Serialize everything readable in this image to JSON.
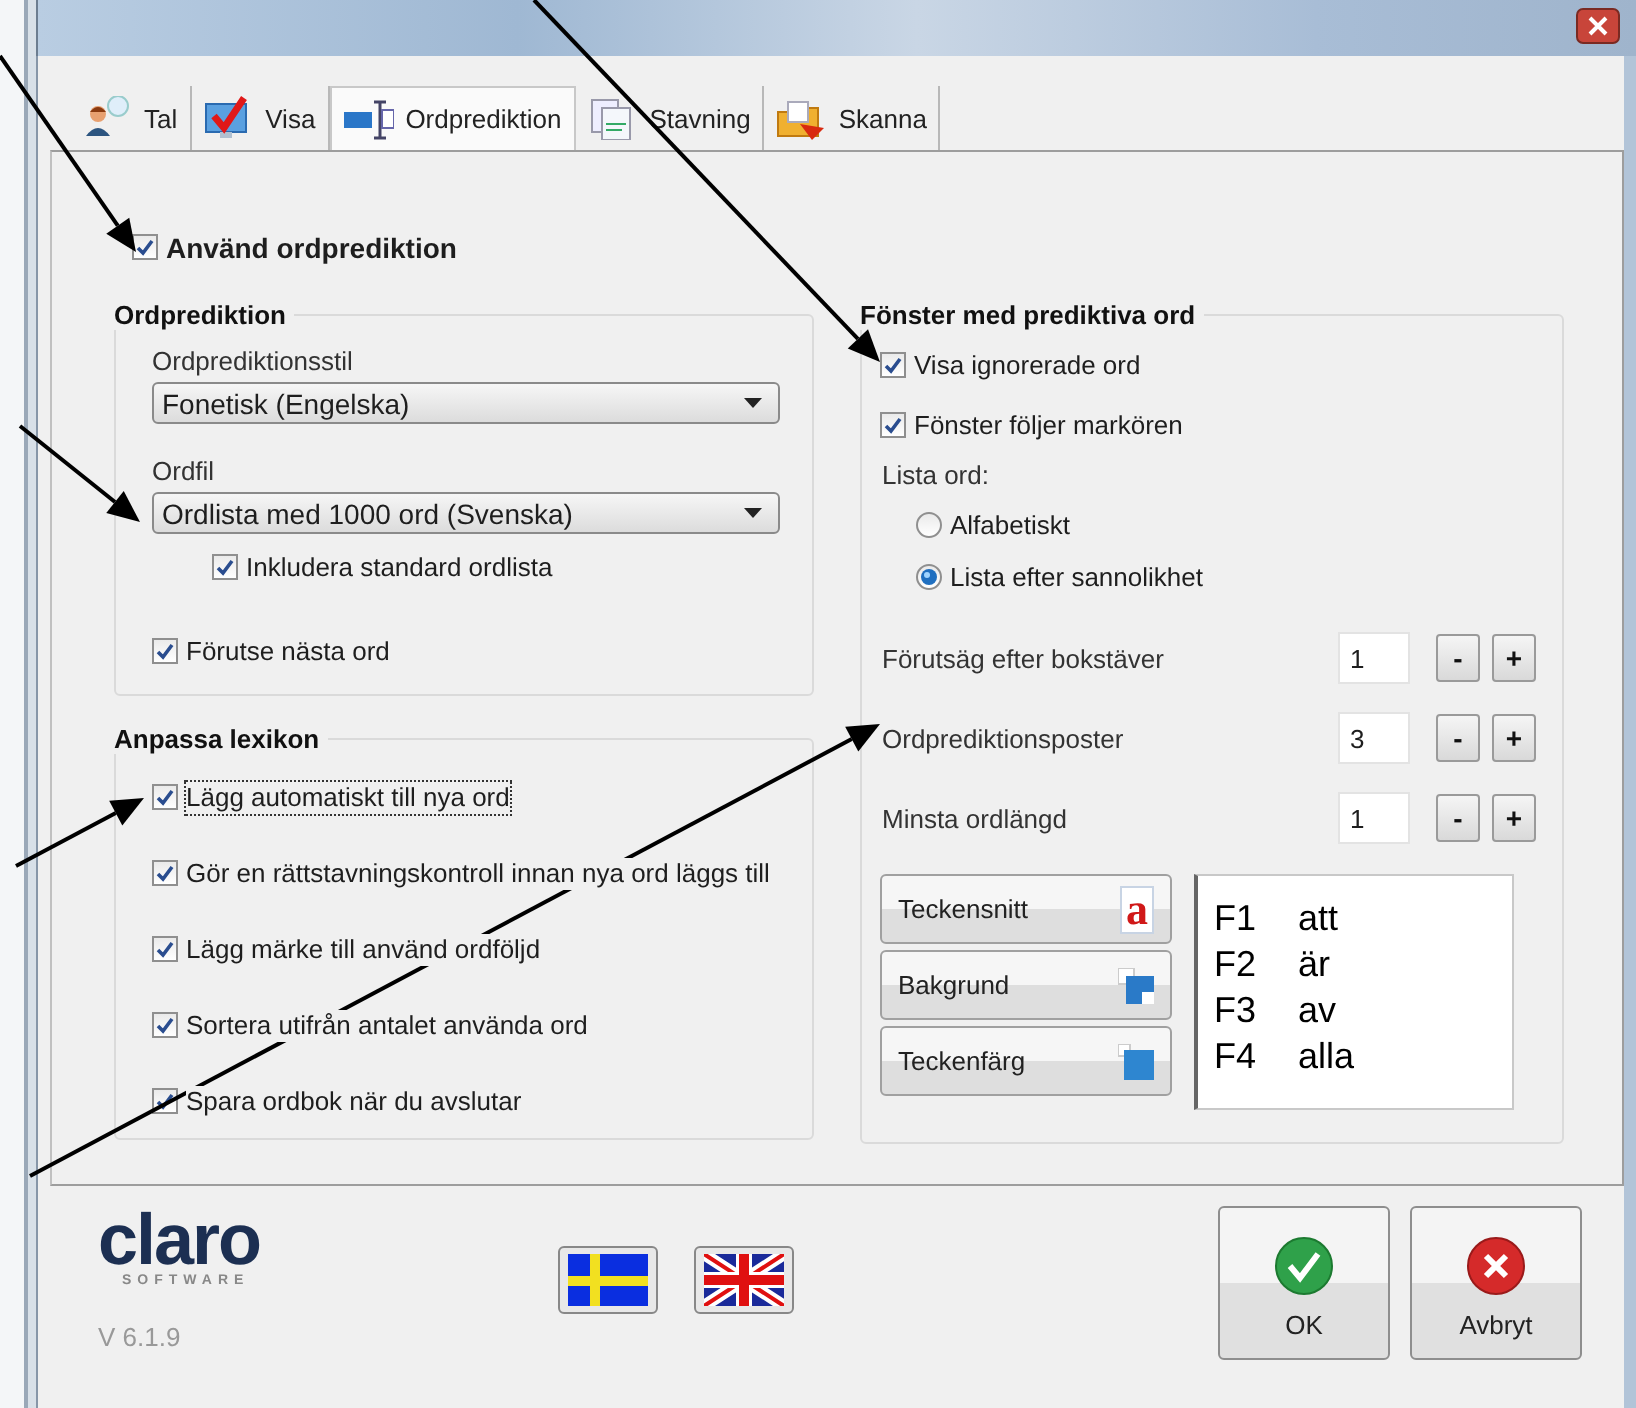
{
  "tabs": [
    {
      "label": "Tal",
      "kind": "person",
      "selected": false
    },
    {
      "label": "Visa",
      "kind": "check",
      "selected": false
    },
    {
      "label": "Ordprediktion",
      "kind": "cursor",
      "selected": true
    },
    {
      "label": "Stavning",
      "kind": "doc",
      "selected": false
    },
    {
      "label": "Skanna",
      "kind": "folder",
      "selected": false
    }
  ],
  "use_prediction": {
    "label": "Använd ordprediktion",
    "checked": true
  },
  "prediction_group": {
    "title": "Ordprediktion",
    "style_label": "Ordprediktionsstil",
    "style_value": "Fonetisk (Engelska)",
    "file_label": "Ordfil",
    "file_value": "Ordlista med 1000 ord (Svenska)",
    "include_standard": {
      "label": "Inkludera standard ordlista",
      "checked": true
    },
    "predict_next": {
      "label": "Förutse nästa ord",
      "checked": true
    }
  },
  "lexicon_group": {
    "title": "Anpassa lexikon",
    "items": [
      {
        "label": "Lägg automatiskt till nya ord",
        "checked": true,
        "focused": true
      },
      {
        "label": "Gör en rättstavningskontroll innan nya ord läggs till",
        "checked": true,
        "focused": false
      },
      {
        "label": "Lägg märke till använd ordföljd",
        "checked": true,
        "focused": false
      },
      {
        "label": "Sortera utifrån antalet använda ord",
        "checked": true,
        "focused": false
      },
      {
        "label": "Spara ordbok när du avslutar",
        "checked": true,
        "focused": false
      }
    ]
  },
  "window_group": {
    "title": "Fönster med prediktiva ord",
    "checks": [
      {
        "label": "Visa ignorerade ord",
        "checked": true
      },
      {
        "label": "Fönster följer markören",
        "checked": true
      }
    ],
    "list_label": "Lista ord:",
    "list_options": [
      {
        "label": "Alfabetiskt",
        "selected": false
      },
      {
        "label": "Lista efter sannolikhet",
        "selected": true
      }
    ],
    "spinners": [
      {
        "label": "Förutsäg efter bokstäver",
        "value": "1",
        "minus": "-",
        "plus": "+"
      },
      {
        "label": "Ordprediktionsposter",
        "value": "3",
        "minus": "-",
        "plus": "+"
      },
      {
        "label": "Minsta ordlängd",
        "value": "1",
        "minus": "-",
        "plus": "+"
      }
    ],
    "style_buttons": [
      {
        "label": "Teckensnitt",
        "kind": "font",
        "glyph": "a"
      },
      {
        "label": "Bakgrund",
        "kind": "background"
      },
      {
        "label": "Teckenfärg",
        "kind": "color"
      }
    ],
    "preview": [
      {
        "key": "F1",
        "word": "att"
      },
      {
        "key": "F2",
        "word": "är"
      },
      {
        "key": "F3",
        "word": "av"
      },
      {
        "key": "F4",
        "word": "alla"
      }
    ]
  },
  "footer": {
    "logo": "claro",
    "tagline": "SOFTWARE",
    "version": "V 6.1.9",
    "flags": [
      {
        "kind": "se"
      },
      {
        "kind": "gb"
      }
    ],
    "buttons": [
      {
        "label": "OK",
        "kind": "ok"
      },
      {
        "label": "Avbryt",
        "kind": "cancel"
      }
    ]
  }
}
